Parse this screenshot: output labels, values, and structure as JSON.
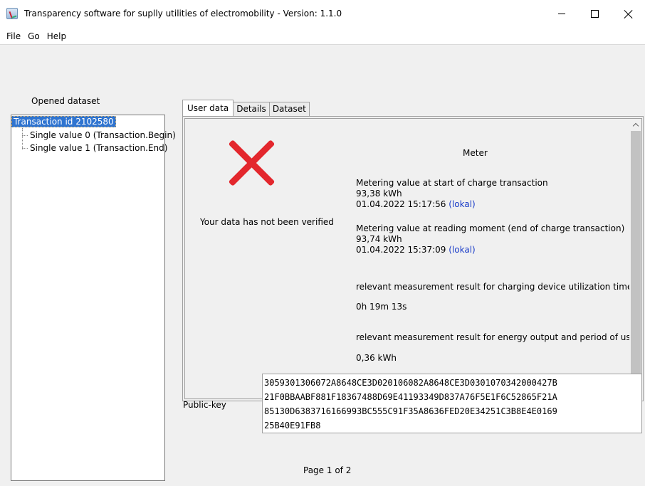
{
  "window": {
    "title": "Transparency software for suplly utilities of electromobility - Version: 1.1.0"
  },
  "menu": [
    "File",
    "Go",
    "Help"
  ],
  "sidebar": {
    "label": "Opened dataset",
    "tree": {
      "root": "Transaction id 2102580",
      "children": [
        "Single value 0 (Transaction.Begin)",
        "Single value 1 (Transaction.End)"
      ]
    }
  },
  "tabs": [
    "User data",
    "Details",
    "Dataset"
  ],
  "active_tab": "User data",
  "user_data": {
    "verification_status": "Your data has not been verified",
    "status_color": "#e3272d",
    "meter_title": "Meter",
    "start": {
      "label": "Metering value at start of charge transaction",
      "value": "93,38 kWh",
      "timestamp": "01.04.2022 15:17:56",
      "timezone": "(lokal)"
    },
    "end": {
      "label": "Metering value at reading moment (end of charge transaction)",
      "value": "93,74 kWh",
      "timestamp": "01.04.2022 15:37:09",
      "timezone": "(lokal)"
    },
    "utilization": {
      "label": "relevant measurement result for charging device utilization time",
      "value": "0h 19m 13s"
    },
    "energy": {
      "label": "relevant measurement result for energy output and period of use",
      "value": "0,36 kWh"
    }
  },
  "public_key": {
    "label": "Public-key",
    "lines": [
      "3059301306072A8648CE3D020106082A8648CE3D0301070342000427B",
      "21F0BBAABF881F18367488D69E41193349D837A76F5E1F6C52865F21A",
      "85130D6383716166993BC555C91F35A8636FED20E34251C3B8E4E0169",
      "25B40E91FB8"
    ]
  },
  "pagination": "Page 1 of 2"
}
